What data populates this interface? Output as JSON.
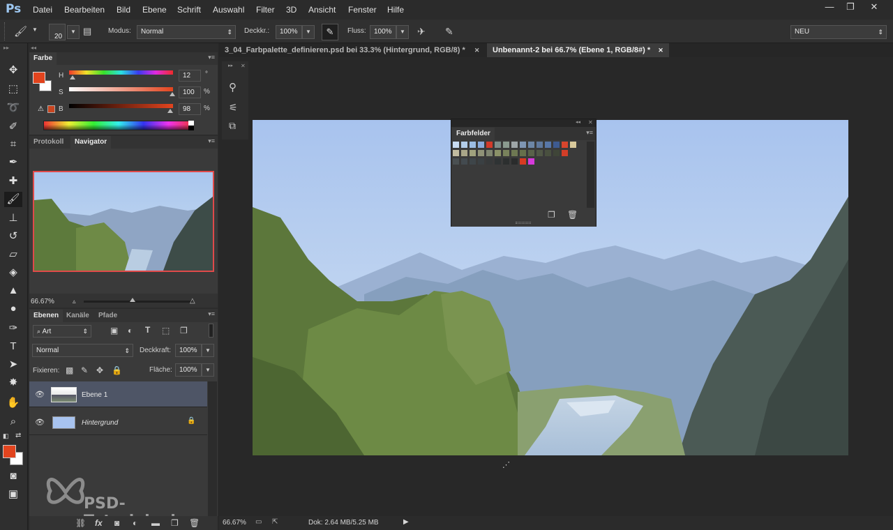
{
  "app": {
    "logo": "Ps"
  },
  "menu": [
    "Datei",
    "Bearbeiten",
    "Bild",
    "Ebene",
    "Schrift",
    "Auswahl",
    "Filter",
    "3D",
    "Ansicht",
    "Fenster",
    "Hilfe"
  ],
  "window_controls": {
    "minimize": "—",
    "restore": "❐",
    "close": "✕"
  },
  "options": {
    "brush_size": "20",
    "modus_label": "Modus:",
    "modus_value": "Normal",
    "deckkr_label": "Deckkr.:",
    "deckkr_value": "100%",
    "fluss_label": "Fluss:",
    "fluss_value": "100%",
    "workspace_value": "NEU"
  },
  "color_panel": {
    "tab": "Farbe",
    "h_label": "H",
    "h_value": "12",
    "h_unit": "°",
    "s_label": "S",
    "s_value": "100",
    "s_unit": "%",
    "b_label": "B",
    "b_value": "98",
    "b_unit": "%",
    "foreground": "#e2441e",
    "background": "#ffffff"
  },
  "navigator_panel": {
    "tab_protokoll": "Protokoll",
    "tab_navigator": "Navigator",
    "zoom": "66.67%",
    "zoom_slider": 0.55
  },
  "layers_panel": {
    "tab_ebenen": "Ebenen",
    "tab_kanaele": "Kanäle",
    "tab_pfade": "Pfade",
    "filter_value": "Art",
    "blend_mode": "Normal",
    "deckkraft_label": "Deckkraft:",
    "deckkraft_value": "100%",
    "fixieren_label": "Fixieren:",
    "flaeche_label": "Fläche:",
    "flaeche_value": "100%",
    "layers": [
      {
        "name": "Ebene 1",
        "selected": true
      },
      {
        "name": "Hintergrund",
        "locked": true
      }
    ]
  },
  "documents": {
    "tabs": [
      {
        "label": "3_04_Farbpalette_definieren.psd bei 33.3% (Hintergrund, RGB/8) *",
        "active": false
      },
      {
        "label": "Unbenannt-2 bei 66.7% (Ebene 1, RGB/8#) *",
        "active": true
      }
    ]
  },
  "swatches_panel": {
    "title": "Farbfelder",
    "rows": [
      [
        "#c9dcf2",
        "#b3cde9",
        "#9cbde3",
        "#88aadb",
        "#d23a2a",
        "#7c8d8a",
        "#8a9a8f",
        "#9fa6a8",
        "#7f96b3",
        "#6d86a6",
        "#5f789c",
        "#5877a8",
        "#3e5a90",
        "#d8452d",
        "#d8c99b"
      ],
      [
        "#c2bca0",
        "#a9a689",
        "#a0a27e",
        "#8f9277",
        "#7f8570",
        "#8b9268",
        "#79825c",
        "#6e7852",
        "#66704b",
        "#59624a",
        "#505746",
        "#49503f",
        "#3f4538",
        "#d23e28"
      ],
      [
        "#4a5052",
        "#434a4f",
        "#3e4549",
        "#3a4043",
        "#36393a",
        "#2f3334",
        "#2c2f2f",
        "#2a2c2c",
        "#d83a22",
        "#d63adb"
      ]
    ]
  },
  "status": {
    "zoom": "66.67%",
    "doc_info": "Dok: 2.64 MB/5.25 MB"
  },
  "watermark": "PSD-Tutorials.de",
  "colors": {
    "accent_red": "#e2441e",
    "navigator_frame": "#e04a4a",
    "selected_layer": "#4e5566"
  }
}
